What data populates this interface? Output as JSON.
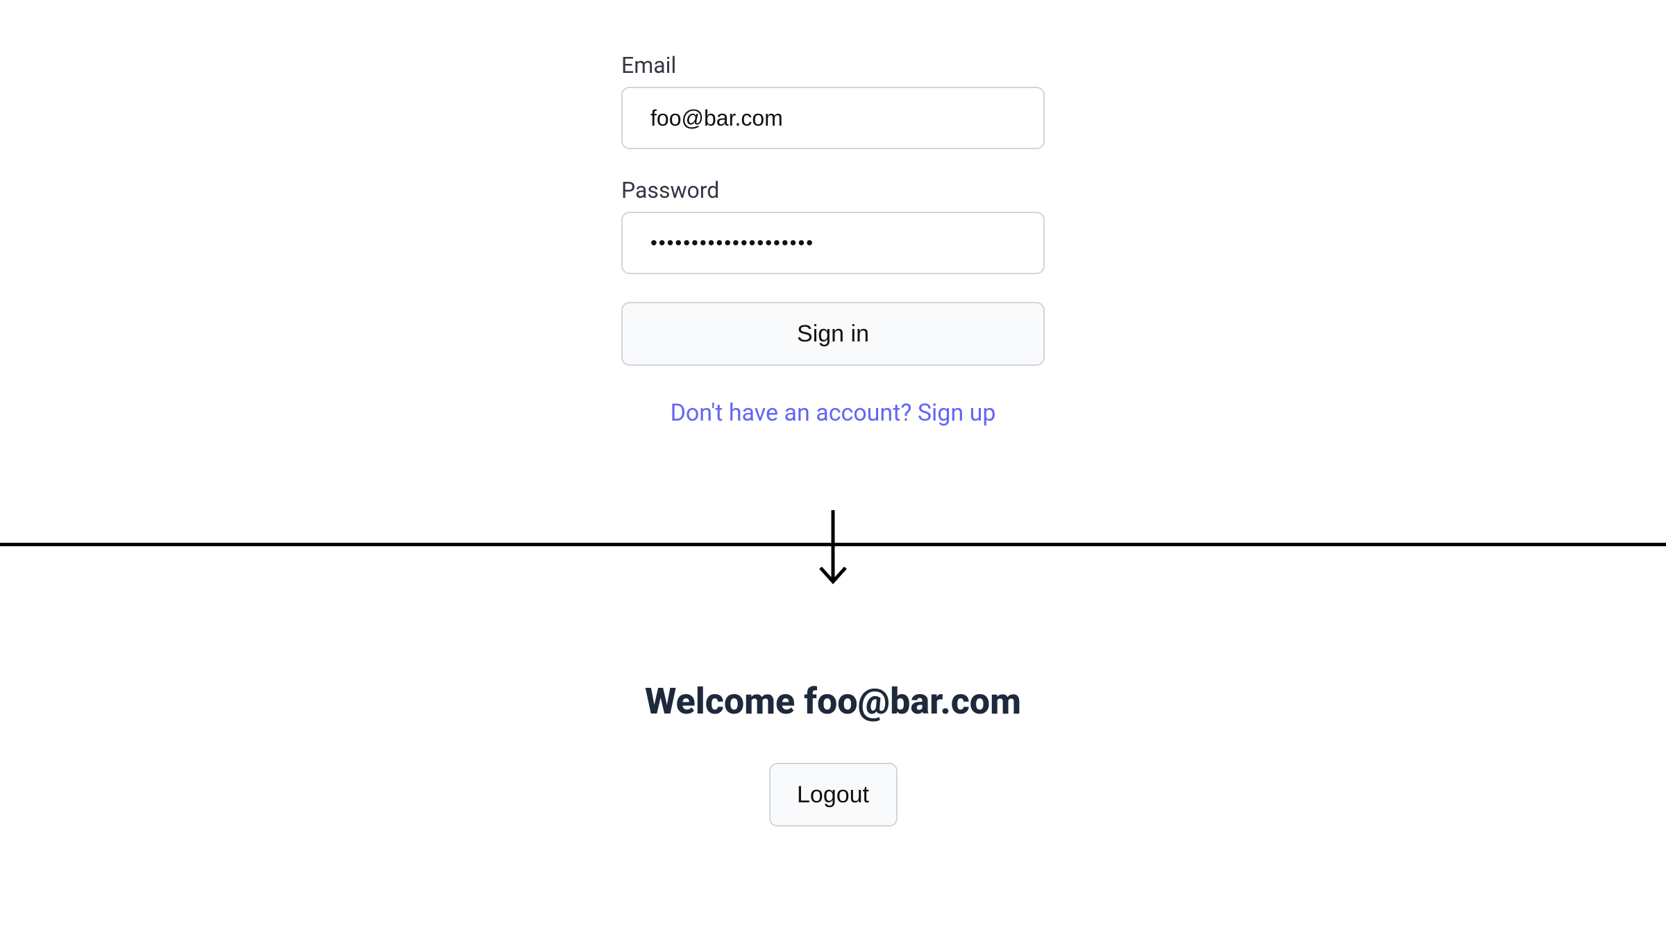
{
  "form": {
    "email_label": "Email",
    "email_value": "foo@bar.com",
    "password_label": "Password",
    "password_value": "••••••••••••••••••••",
    "signin_label": "Sign in",
    "signup_link_text": "Don't have an account? Sign up"
  },
  "welcome": {
    "text": "Welcome foo@bar.com",
    "logout_label": "Logout"
  }
}
